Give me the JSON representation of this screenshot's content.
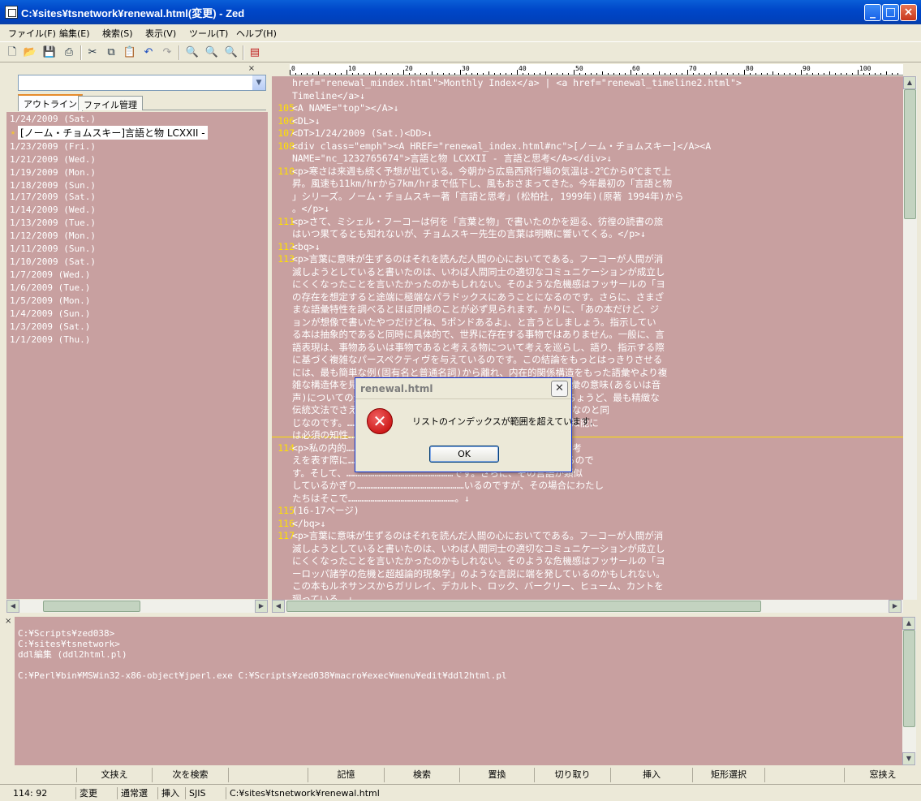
{
  "window": {
    "title": "C:¥sites¥tsnetwork¥renewal.html(変更) - Zed"
  },
  "menu": [
    "ファイル(F)",
    "編集(E)",
    "検索(S)",
    "表示(V)",
    "ツール(T)",
    "ヘルプ(H)"
  ],
  "left_pane": {
    "close": "×",
    "tabs": [
      "アウトライン",
      "ファイル管理"
    ],
    "outline": [
      "1/24/2009 (Sat.)",
      "[ノーム・チョムスキー]言語と物 LCXXII -",
      "1/23/2009 (Fri.)",
      "1/21/2009 (Wed.)",
      "1/19/2009 (Mon.)",
      "1/18/2009 (Sun.)",
      "1/17/2009 (Sat.)",
      "1/14/2009 (Wed.)",
      "1/13/2009 (Tue.)",
      "1/12/2009 (Mon.)",
      "1/11/2009 (Sun.)",
      "1/10/2009 (Sat.)",
      "1/7/2009 (Wed.)",
      "1/6/2009 (Tue.)",
      "1/5/2009 (Mon.)",
      "1/4/2009 (Sun.)",
      "1/3/2009 (Sat.)",
      "1/1/2009 (Thu.)"
    ]
  },
  "ruler": [
    "0",
    "10",
    "20",
    "30",
    "40",
    "50",
    "60",
    "70",
    "80",
    "90",
    "100"
  ],
  "editor": {
    "lines": [
      {
        "n": "",
        "t": "href=\"renewal_mindex.html\">Monthly Index</a> | <a href=\"renewal_timeline2.html\">"
      },
      {
        "n": "",
        "t": "Timeline</a>↓"
      },
      {
        "n": "105",
        "t": "<A NAME=\"top\"></A>↓"
      },
      {
        "n": "106",
        "t": "<DL>↓"
      },
      {
        "n": "107",
        "t": "<DT>1/24/2009 (Sat.)<DD>↓"
      },
      {
        "n": "108",
        "t": "<div class=\"emph\"><A HREF=\"renewal_index.html#nc\">[ノーム・チョムスキー]</A><A"
      },
      {
        "n": "",
        "t": "NAME=\"nc_1232765674\">言語と物 LCXXII - 言語と思考</A></div>↓"
      },
      {
        "n": "110",
        "t": "<p>寒さは来週も続く予想が出ている。今朝から広島西飛行場の気温は-2℃から0℃まで上"
      },
      {
        "n": "",
        "t": "昇。風速も11km/hrから7km/hrまで低下し、風もおさまってきた。今年最初の「言語と物"
      },
      {
        "n": "",
        "t": "」シリーズ。ノーム・チョムスキー著「言語と思考」(松柏社, 1999年)(原著 1994年)から"
      },
      {
        "n": "",
        "t": "。</p>↓"
      },
      {
        "n": "111",
        "t": "<p>さて、ミシェル・フーコーは何を「言葉と物」で書いたのかを廻る、彷徨の読書の旅"
      },
      {
        "n": "",
        "t": "はいつ果てるとも知れないが、チョムスキー先生の言葉は明瞭に響いてくる。</p>↓"
      },
      {
        "n": "112",
        "t": "<bq>↓"
      },
      {
        "n": "113",
        "t": "<p>言葉に意味が生ずるのはそれを読んだ人間の心においてである。フーコーが人間が消"
      },
      {
        "n": "",
        "t": "滅しようとしていると書いたのは、いわば人間同士の適切なコミュニケーションが成立し"
      },
      {
        "n": "",
        "t": "にくくなったことを言いたかったのかもしれない。そのような危機感はフッサールの「ヨ"
      },
      {
        "n": "",
        "t": "の存在を想定すると途端に極端なパラドックスにあうことになるのです。さらに、さまざ"
      },
      {
        "n": "",
        "t": "まな語彙特性を調べるとほぼ同様のことが必ず見られます。かりに、「あの本だけど、ジ"
      },
      {
        "n": "",
        "t": "ョンが想像で書いたやつだけどね、5ポンドあるよ」、と言うとしましょう。指示してい"
      },
      {
        "n": "",
        "t": "る本は抽象的であると同時に具体的で、世界に存在する事物ではありません。一般に、言"
      },
      {
        "n": "",
        "t": "語表現は、事物あるいは事物であると考える物について考えを巡らし、語り、指示する際"
      },
      {
        "n": "",
        "t": "に基づく複雑なパースペクティヴを与えているのです。この結論をもっとはっきりさせる"
      },
      {
        "n": "",
        "t": "には、最も簡単な例(固有名と普通名詞)から離れ、内在的関係構造をもった語彙やより複"
      },
      {
        "n": "",
        "t": "雑な構造体を見ているだけでよいのです。最も精緻な辞書でさえ語彙の意味(あるいは音"
      },
      {
        "n": "",
        "t": "声)についての素描的なヒントを与えているだけなのです。これはちょうど、最も精緻な"
      },
      {
        "n": "",
        "t": "伝統文法でさえ……………………………………………………ヒントを与えているだけなのと同"
      },
      {
        "n": "",
        "t": "じなのです。……………………………………………………もしれません。そしてその知能に"
      },
      {
        "n": "",
        "t": "は必須の知性……………………………………………………独立しているのです。↓"
      },
      {
        "n": "114",
        "t": "<p>私の内的……………………………………………ですが、それがわたしが自分の考"
      },
      {
        "n": "",
        "t": "えを表す際に…………………………………………………クティヴと方法を与えているので"
      },
      {
        "n": "",
        "t": "す。そして、…………………………………………………です。さらに、その言語が類似"
      },
      {
        "n": "",
        "t": "しているかぎり…………………………………………………いるのですが、その場合にわたし"
      },
      {
        "n": "",
        "t": "たちはそこで…………………………………………………。↓"
      },
      {
        "n": "115",
        "t": "(16-17ページ)"
      },
      {
        "n": "116",
        "t": "</bq>↓"
      },
      {
        "n": "117",
        "t": "<p>言葉に意味が生ずるのはそれを読んだ人間の心においてである。フーコーが人間が消"
      },
      {
        "n": "",
        "t": "滅しようとしていると書いたのは、いわば人間同士の適切なコミュニケーションが成立し"
      },
      {
        "n": "",
        "t": "にくくなったことを言いたかったのかもしれない。そのような危機感はフッサールの「ヨ"
      },
      {
        "n": "",
        "t": "ーロッパ諸学の危機と超越論的現象学」のような言説に端を発しているのかもしれない。"
      },
      {
        "n": "",
        "t": "この本もルネサンスからガリレイ、デカルト、ロック、バークリー、ヒューム、カントを"
      },
      {
        "n": "",
        "t": "廻っている。↓"
      },
      {
        "n": "118",
        "t": "<p>新年も1月も残り1週間を残すのみとなった。世界の経済的凋落を見ていると機能不全"
      },
      {
        "n": "",
        "t": "を来たした貨幣経済に奇妙さを覚えざるを得ないわけだが、仮想的な経済活動によって人"
      },
      {
        "n": "",
        "t": "為的に生じたリアルな結果は各国の財政出動という仮想的な人為的な作用で解決すべきも"
      },
      {
        "n": "",
        "t": "のなのだろうと思う。もともと貨幣は仮想に過ぎないのだから。金本位制であったときも"
      }
    ]
  },
  "console": {
    "close": "×",
    "lines": [
      "C:¥Scripts¥zed038>",
      "C:¥sites¥tsnetwork>",
      "ddl編集 (ddl2html.pl)",
      "",
      "C:¥Perl¥bin¥MSWin32-x86-object¥jperl.exe C:¥Scripts¥zed038¥macro¥exec¥menu¥edit¥ddl2html.pl"
    ]
  },
  "fkeys": [
    "",
    "文挟え",
    "次を検索",
    "",
    "記憶",
    "検索",
    "置換",
    "切り取り",
    "挿入",
    "矩形選択",
    "",
    "窓挟え"
  ],
  "status": {
    "position": "114:  92",
    "modified": "変更",
    "mode": "通常選",
    "insert": "挿入",
    "encoding": "SJIS",
    "path": "C:¥sites¥tsnetwork¥renewal.html"
  },
  "dialog": {
    "title": "renewal.html",
    "message": "リストのインデックスが範囲を超えています.",
    "ok": "OK"
  }
}
